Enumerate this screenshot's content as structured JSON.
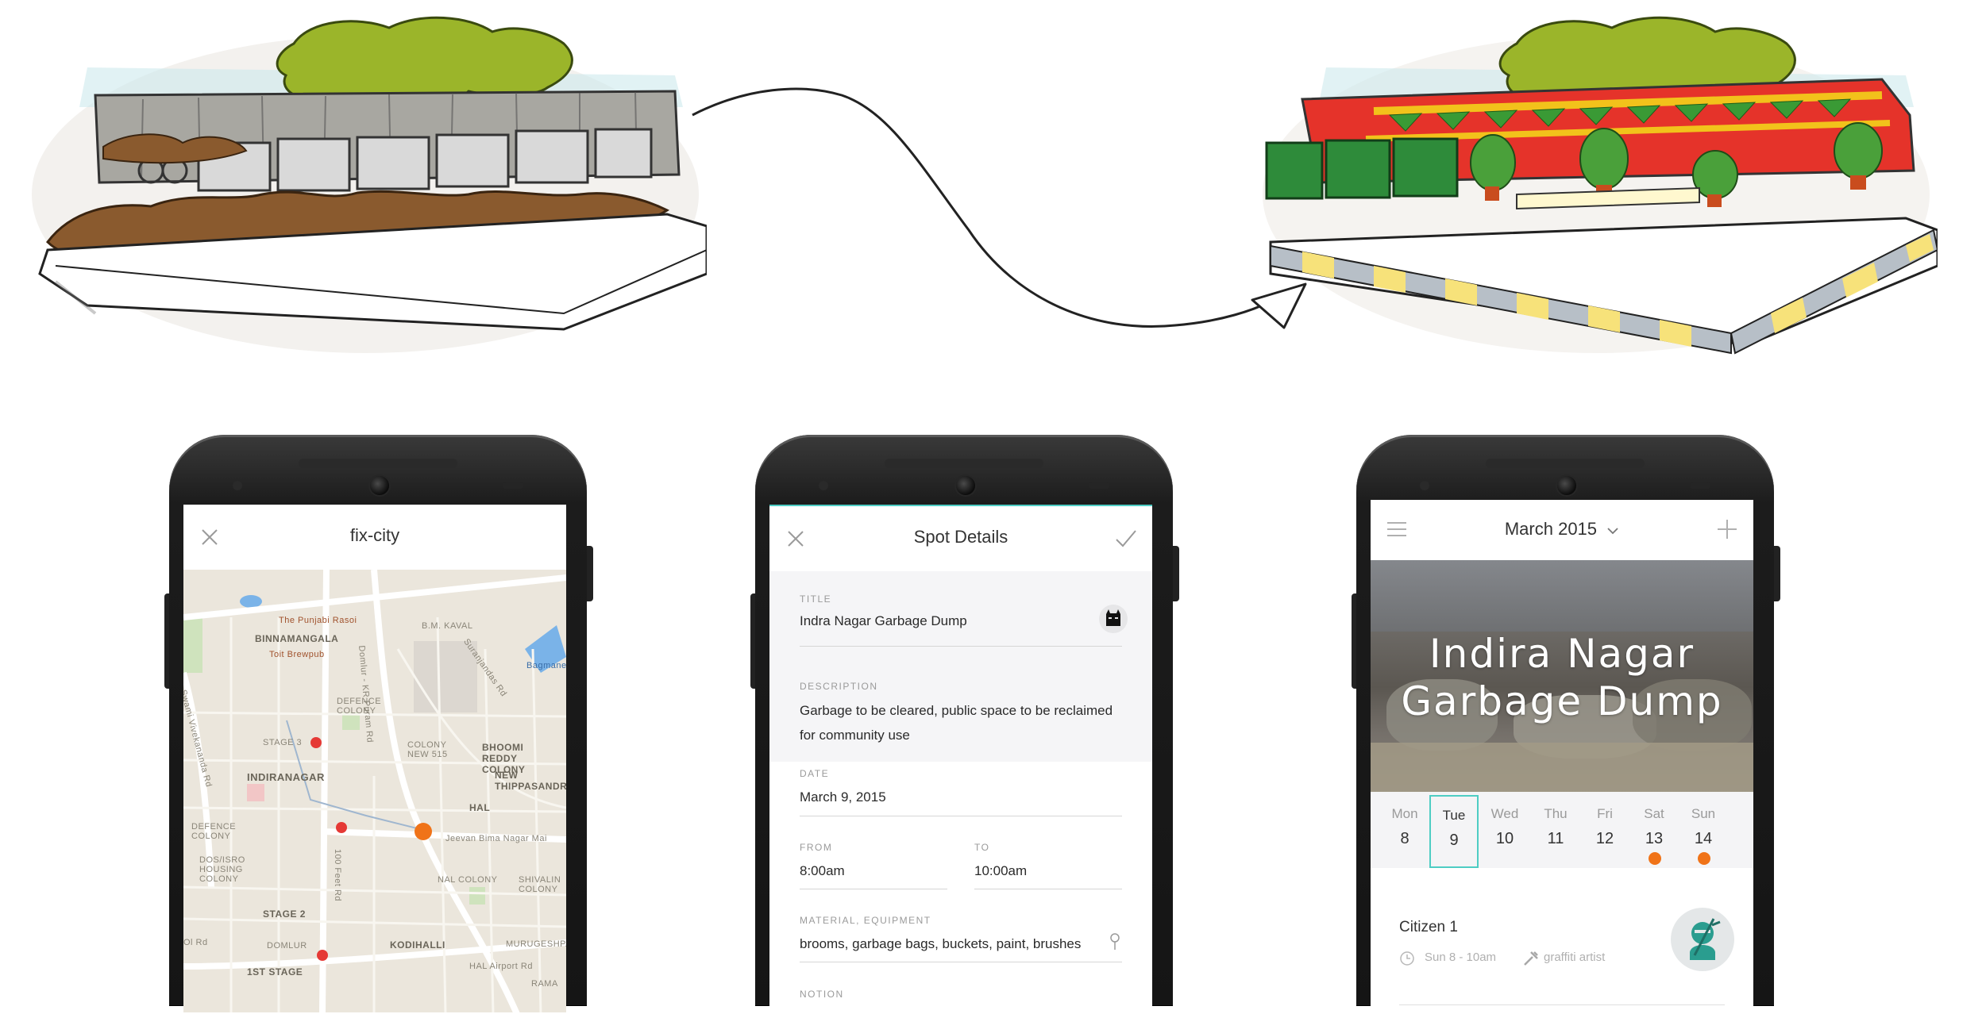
{
  "illustrations": {
    "before": "before-illustration",
    "after": "after-illustration",
    "connector": "transform-arrow"
  },
  "colors": {
    "accent_teal": "#4ecdc4",
    "pin_red": "#e53935",
    "pin_orange": "#f07318",
    "map_bg": "#ebe6dc"
  },
  "screen1": {
    "app_title": "fix-city",
    "close_icon": "close-icon",
    "map_labels": {
      "punjabi_rasoi": "The Punjabi Rasoi",
      "binnamangala": "BINNAMANGALA",
      "toit": "Toit Brewpub",
      "bm_kaval": "B.M. KAVAL",
      "domlur_road": "Domlur - KR Puram Rd",
      "suranjandas": "Suranjandas Rd",
      "bagmane": "Bagmane",
      "defence_colony": "DEFENCE COLONY",
      "stage3": "STAGE 3",
      "colony_new": "COLONY NEW 515",
      "bhoomi": "BHOOMI REDDY COLONY",
      "indiranagar": "INDIRANAGAR",
      "new_thippasandra": "NEW THIPPASANDR",
      "hal": "HAL",
      "defence_colony2": "DEFENCE COLONY",
      "jeevan": "Jeevan Bima Nagar Mai",
      "dos_isro": "DOS/ISRO HOUSING COLONY",
      "hundred_feet": "100 Feet Rd",
      "nal_colony": "NAL COLONY",
      "shivalin": "SHIVALIN COLONY",
      "stage2": "STAGE 2",
      "domlur": "DOMLUR",
      "kodihalli": "KODIHALLI",
      "murugeshpa": "MURUGESHPA",
      "ol_rd": "Ol Rd",
      "first_stage": "1ST STAGE",
      "hal_airport": "HAL Airport Rd",
      "rama": "RAMA",
      "sarjapur_rd": "Swami Vivekananda Rd"
    }
  },
  "screen2": {
    "app_title": "Spot Details",
    "close_icon": "close-icon",
    "confirm_icon": "check-icon",
    "fields": {
      "title_label": "TITLE",
      "title_value": "Indra Nagar Garbage Dump",
      "description_label": "DESCRIPTION",
      "description_value": "Garbage to be cleared, public space to be reclaimed for community use",
      "date_label": "DATE",
      "date_value": "March 9, 2015",
      "from_label": "FROM",
      "from_value": "8:00am",
      "to_label": "TO",
      "to_value": "10:00am",
      "material_label": "MATERIAL, EQUIPMENT",
      "material_value": "brooms, garbage bags, buckets, paint, brushes",
      "next_label": "NOTION"
    }
  },
  "screen3": {
    "menu_icon": "menu-icon",
    "month_label": "March 2015",
    "chevron_icon": "chevron-down-icon",
    "add_icon": "plus-icon",
    "hero_title": "Indira Nagar Garbage Dump",
    "days": [
      {
        "name": "Mon",
        "date": "8",
        "selected": false,
        "dot": false
      },
      {
        "name": "Tue",
        "date": "9",
        "selected": true,
        "dot": false
      },
      {
        "name": "Wed",
        "date": "10",
        "selected": false,
        "dot": false
      },
      {
        "name": "Thu",
        "date": "11",
        "selected": false,
        "dot": false
      },
      {
        "name": "Fri",
        "date": "12",
        "selected": false,
        "dot": false
      },
      {
        "name": "Sat",
        "date": "13",
        "selected": false,
        "dot": true
      },
      {
        "name": "Sun",
        "date": "14",
        "selected": false,
        "dot": true
      }
    ],
    "event": {
      "name": "Citizen 1",
      "time": "Sun 8 - 10am",
      "role": "graffiti artist",
      "clock_icon": "clock-icon",
      "tools_icon": "tools-icon",
      "avatar_icon": "ninja-avatar-icon"
    }
  }
}
